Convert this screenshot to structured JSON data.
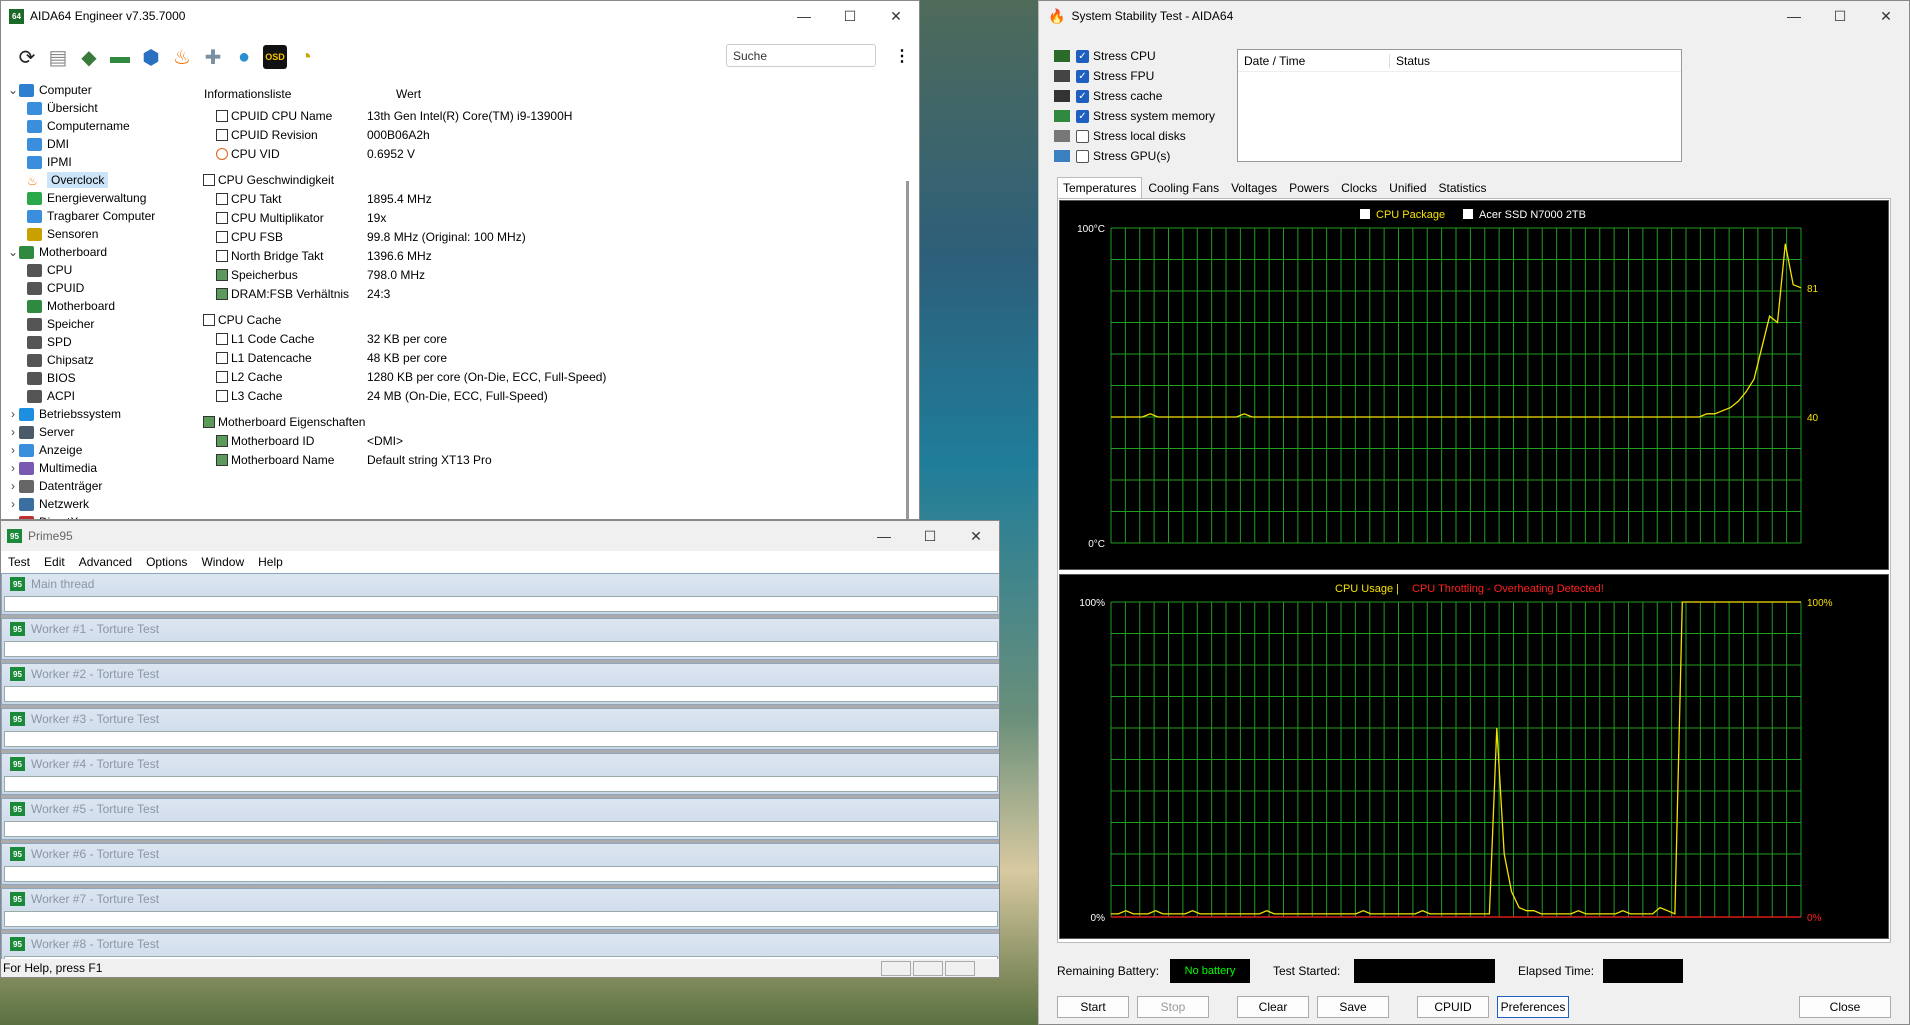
{
  "aida": {
    "title": "AIDA64 Engineer v7.35.7000",
    "logo": "64",
    "search_placeholder": "Suche",
    "toolbar_icons": [
      "refresh-icon",
      "report-icon",
      "motherboard-icon",
      "memory-icon",
      "network-icon",
      "flame-icon",
      "tools-icon",
      "user-icon",
      "osd-icon",
      "sensor-icon"
    ],
    "osd_label": "OSD",
    "tree": [
      {
        "label": "Computer",
        "level": 0,
        "exp": "v",
        "icon": "computer"
      },
      {
        "label": "Übersicht",
        "level": 1,
        "icon": "monitor"
      },
      {
        "label": "Computername",
        "level": 1,
        "icon": "monitor"
      },
      {
        "label": "DMI",
        "level": 1,
        "icon": "monitor"
      },
      {
        "label": "IPMI",
        "level": 1,
        "icon": "monitor"
      },
      {
        "label": "Overclock",
        "level": 1,
        "icon": "flame",
        "selected": true
      },
      {
        "label": "Energieverwaltung",
        "level": 1,
        "icon": "power"
      },
      {
        "label": "Tragbarer Computer",
        "level": 1,
        "icon": "monitor"
      },
      {
        "label": "Sensoren",
        "level": 1,
        "icon": "sensor"
      },
      {
        "label": "Motherboard",
        "level": 0,
        "exp": "v",
        "icon": "board"
      },
      {
        "label": "CPU",
        "level": 1,
        "icon": "chip"
      },
      {
        "label": "CPUID",
        "level": 1,
        "icon": "chip"
      },
      {
        "label": "Motherboard",
        "level": 1,
        "icon": "board"
      },
      {
        "label": "Speicher",
        "level": 1,
        "icon": "chip"
      },
      {
        "label": "SPD",
        "level": 1,
        "icon": "chip"
      },
      {
        "label": "Chipsatz",
        "level": 1,
        "icon": "chip"
      },
      {
        "label": "BIOS",
        "level": 1,
        "icon": "chip"
      },
      {
        "label": "ACPI",
        "level": 1,
        "icon": "chip"
      },
      {
        "label": "Betriebssystem",
        "level": 0,
        "exp": ">",
        "icon": "windows"
      },
      {
        "label": "Server",
        "level": 0,
        "exp": ">",
        "icon": "server"
      },
      {
        "label": "Anzeige",
        "level": 0,
        "exp": ">",
        "icon": "monitor"
      },
      {
        "label": "Multimedia",
        "level": 0,
        "exp": ">",
        "icon": "media"
      },
      {
        "label": "Datenträger",
        "level": 0,
        "exp": ">",
        "icon": "disk"
      },
      {
        "label": "Netzwerk",
        "level": 0,
        "exp": ">",
        "icon": "network"
      },
      {
        "label": "DirectX",
        "level": 0,
        "exp": ">",
        "icon": "dx"
      }
    ],
    "list_headers": {
      "field": "Informationsliste",
      "value": "Wert"
    },
    "list": [
      {
        "type": "row",
        "k": "CPUID CPU Name",
        "v": "13th Gen Intel(R) Core(TM) i9-13900H",
        "icon": "chip"
      },
      {
        "type": "row",
        "k": "CPUID Revision",
        "v": "000B06A2h",
        "icon": "chip"
      },
      {
        "type": "row",
        "k": "CPU VID",
        "v": "0.6952 V",
        "icon": "volt"
      },
      {
        "type": "group",
        "k": "CPU Geschwindigkeit",
        "icon": "chip"
      },
      {
        "type": "row",
        "k": "CPU Takt",
        "v": "1895.4 MHz",
        "icon": "chip"
      },
      {
        "type": "row",
        "k": "CPU Multiplikator",
        "v": "19x",
        "icon": "chip"
      },
      {
        "type": "row",
        "k": "CPU FSB",
        "v": "99.8 MHz  (Original: 100 MHz)",
        "icon": "chip"
      },
      {
        "type": "row",
        "k": "North Bridge Takt",
        "v": "1396.6 MHz",
        "icon": "chip"
      },
      {
        "type": "row",
        "k": "Speicherbus",
        "v": "798.0 MHz",
        "icon": "ram"
      },
      {
        "type": "row",
        "k": "DRAM:FSB Verhältnis",
        "v": "24:3",
        "icon": "ram"
      },
      {
        "type": "group",
        "k": "CPU Cache",
        "icon": "chip"
      },
      {
        "type": "row",
        "k": "L1 Code Cache",
        "v": "32 KB per core",
        "icon": "chip"
      },
      {
        "type": "row",
        "k": "L1 Datencache",
        "v": "48 KB per core",
        "icon": "chip"
      },
      {
        "type": "row",
        "k": "L2 Cache",
        "v": "1280 KB per core  (On-Die, ECC, Full-Speed)",
        "icon": "chip"
      },
      {
        "type": "row",
        "k": "L3 Cache",
        "v": "24 MB  (On-Die, ECC, Full-Speed)",
        "icon": "chip"
      },
      {
        "type": "group",
        "k": "Motherboard Eigenschaften",
        "icon": "board"
      },
      {
        "type": "row",
        "k": "Motherboard ID",
        "v": "<DMI>",
        "icon": "board"
      },
      {
        "type": "row",
        "k": "Motherboard Name",
        "v": "Default string XT13 Pro",
        "icon": "board"
      }
    ]
  },
  "prime": {
    "title": "Prime95",
    "logo": "95",
    "menu": [
      "Test",
      "Edit",
      "Advanced",
      "Options",
      "Window",
      "Help"
    ],
    "children": [
      "Main thread",
      "Worker #1 - Torture Test",
      "Worker #2 - Torture Test",
      "Worker #3 - Torture Test",
      "Worker #4 - Torture Test",
      "Worker #5 - Torture Test",
      "Worker #6 - Torture Test",
      "Worker #7 - Torture Test",
      "Worker #8 - Torture Test"
    ],
    "status": "For Help, press F1"
  },
  "stab": {
    "title": "System Stability Test - AIDA64",
    "checks": [
      {
        "label": "Stress CPU",
        "checked": true
      },
      {
        "label": "Stress FPU",
        "checked": true
      },
      {
        "label": "Stress cache",
        "checked": true
      },
      {
        "label": "Stress system memory",
        "checked": true
      },
      {
        "label": "Stress local disks",
        "checked": false
      },
      {
        "label": "Stress GPU(s)",
        "checked": false
      }
    ],
    "log_headers": {
      "date": "Date / Time",
      "status": "Status"
    },
    "tabs": [
      "Temperatures",
      "Cooling Fans",
      "Voltages",
      "Powers",
      "Clocks",
      "Unified",
      "Statistics"
    ],
    "active_tab": 0,
    "bottom": {
      "battery_label": "Remaining Battery:",
      "battery_value": "No battery",
      "started_label": "Test Started:",
      "elapsed_label": "Elapsed Time:"
    },
    "buttons": [
      "Start",
      "Stop",
      "Clear",
      "Save",
      "CPUID",
      "Preferences",
      "Close"
    ],
    "colors": {
      "grid": "#1f9e1f",
      "trace": "#f5e200",
      "red": "#ff2020",
      "battery_text": "#00ff00"
    }
  },
  "chart_data": [
    {
      "type": "line",
      "title": "",
      "legend": [
        "CPU Package",
        "Acer SSD N7000 2TB"
      ],
      "ylabel_top": "100°C",
      "ylabel_bottom": "0°C",
      "ylim": [
        0,
        100
      ],
      "grid": true,
      "series": [
        {
          "name": "CPU Package",
          "values": [
            40,
            40,
            40,
            40,
            40,
            41,
            40,
            40,
            40,
            40,
            40,
            40,
            40,
            40,
            40,
            40,
            40,
            41,
            40,
            40,
            40,
            40,
            40,
            40,
            40,
            40,
            40,
            40,
            40,
            40,
            40,
            40,
            40,
            40,
            40,
            40,
            40,
            40,
            40,
            40,
            40,
            40,
            40,
            40,
            40,
            40,
            40,
            40,
            40,
            40,
            40,
            40,
            40,
            40,
            40,
            40,
            40,
            40,
            40,
            40,
            40,
            40,
            40,
            40,
            40,
            40,
            40,
            40,
            40,
            40,
            40,
            40,
            40,
            40,
            40,
            40,
            41,
            41,
            42,
            43,
            45,
            48,
            52,
            62,
            72,
            70,
            95,
            82,
            81
          ]
        }
      ],
      "value_labels": [
        "81",
        "40"
      ]
    },
    {
      "type": "line",
      "title": "",
      "legend": [
        "CPU Usage",
        "CPU Throttling - Overheating Detected!"
      ],
      "ylabel_top": "100%",
      "ylabel_bottom": "0%",
      "ylim": [
        0,
        100
      ],
      "grid": true,
      "series": [
        {
          "name": "CPU Usage",
          "values": [
            1,
            1,
            2,
            1,
            1,
            1,
            2,
            1,
            1,
            1,
            1,
            2,
            1,
            1,
            1,
            1,
            1,
            1,
            1,
            1,
            1,
            2,
            1,
            1,
            1,
            1,
            1,
            1,
            1,
            1,
            1,
            1,
            1,
            1,
            2,
            1,
            1,
            1,
            1,
            1,
            1,
            1,
            2,
            1,
            1,
            1,
            1,
            1,
            1,
            1,
            1,
            1,
            60,
            20,
            8,
            3,
            2,
            2,
            1,
            1,
            1,
            1,
            1,
            2,
            1,
            1,
            1,
            1,
            1,
            2,
            1,
            1,
            1,
            1,
            3,
            2,
            1,
            100,
            100,
            100,
            100,
            100,
            100,
            100,
            100,
            100,
            100,
            100,
            100,
            100,
            100,
            100,
            100,
            100
          ]
        },
        {
          "name": "CPU Throttling - Overheating Detected!",
          "values": [
            0
          ]
        }
      ],
      "value_labels": [
        "100%",
        "0%"
      ]
    }
  ]
}
